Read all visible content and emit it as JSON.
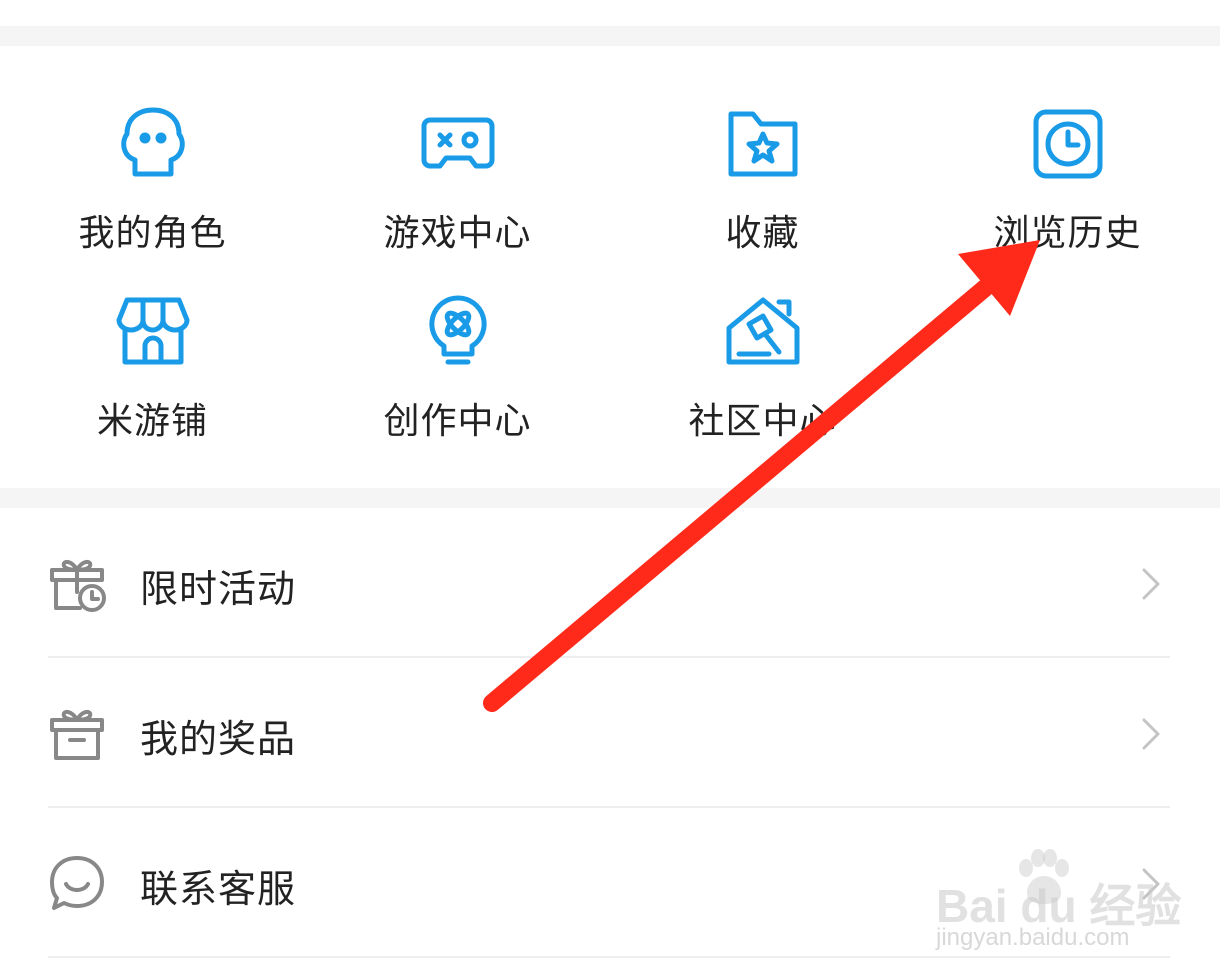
{
  "grid": {
    "items": [
      {
        "label": "我的角色",
        "icon": "character-icon"
      },
      {
        "label": "游戏中心",
        "icon": "gamepad-icon"
      },
      {
        "label": "收藏",
        "icon": "favorites-folder-icon"
      },
      {
        "label": "浏览历史",
        "icon": "history-clock-icon"
      },
      {
        "label": "米游铺",
        "icon": "shop-icon"
      },
      {
        "label": "创作中心",
        "icon": "creation-bulb-icon"
      },
      {
        "label": "社区中心",
        "icon": "community-gavel-icon"
      }
    ]
  },
  "list": {
    "items": [
      {
        "label": "限时活动",
        "icon": "gift-clock-icon"
      },
      {
        "label": "我的奖品",
        "icon": "prize-box-icon"
      },
      {
        "label": "联系客服",
        "icon": "support-chat-icon"
      }
    ]
  },
  "watermark": {
    "main": "Bai du 经验",
    "sub": "jingyan.baidu.com"
  },
  "colors": {
    "accent": "#1a9be8",
    "text": "#222222",
    "muted_icon": "#888888",
    "arrow": "#ff2a1a",
    "divider": "#eeeeee",
    "gap": "#f5f5f5"
  }
}
